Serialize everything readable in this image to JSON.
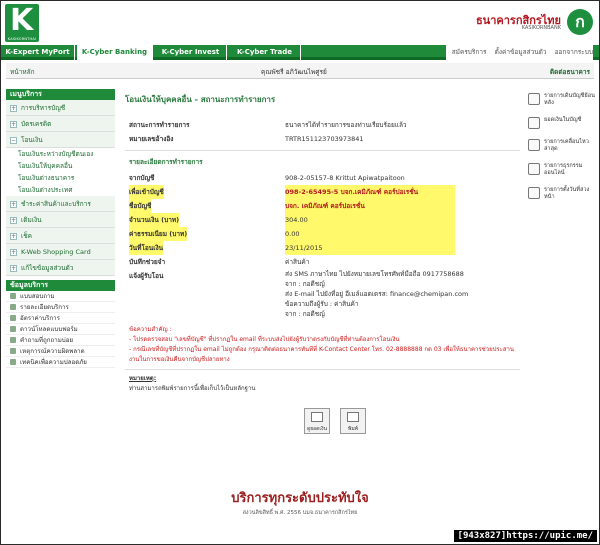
{
  "brand": {
    "logo_text": "K",
    "logo_sub": "KASIKORNTHAI",
    "bank_name": "ธนาคารกสิกรไทย",
    "bank_sub": "KASIKORNBANK"
  },
  "nav": {
    "tabs": [
      "K-Expert MyPort",
      "K-Cyber Banking",
      "K-Cyber Invest",
      "K-Cyber Trade"
    ],
    "active": "K-Cyber Banking"
  },
  "top_links": [
    "สมัครบริการ",
    "ตั้งค่าข้อมูลส่วนตัว",
    "ออกจากระบบ"
  ],
  "crumb": "หน้าหลัก",
  "user_name": "คุณพัชรี อภิวัฒนไพศูรย์",
  "contact": "ติดต่อธนาคาร",
  "sidebar": {
    "title": "เมนูบริการ",
    "items": [
      "การบริหารบัญชี",
      "บัตรเครดิต",
      "โอนเงิน"
    ],
    "subitems": [
      "โอนเงินระหว่างบัญชีตนเอง",
      "โอนเงินให้บุคคลอื่น",
      "โอนเงินต่างธนาคาร",
      "โอนเงินต่างประเทศ"
    ],
    "items2": [
      "ชำระค่าสินค้าและบริการ",
      "เติมเงิน",
      "เช็ค",
      "K-Web Shopping Card",
      "แก้ไขข้อมูลส่วนตัว"
    ],
    "aux_title": "ข้อมูลบริการ",
    "aux": [
      "แบบสอบถาม",
      "รายละเอียดบริการ",
      "อัตราค่าบริการ",
      "ดาวน์โหลดแบบฟอร์ม",
      "คำถามที่ถูกถามบ่อย",
      "เหตุการณ์ความผิดพลาด",
      "เทคนิคเพื่อความปลอดภัย"
    ]
  },
  "main": {
    "title": "โอนเงินให้บุคคลอื่น - สถานะการทำรายการ",
    "status_label": "สถานะการทำรายการ",
    "status_value": "ธนาคารได้ทำรายการของท่านเรียบร้อยแล้ว",
    "ref_label": "หมายเลขอ้างอิง",
    "ref_value": "TRTR151123703973841",
    "section": "รายละเอียดการทำรายการ",
    "from_label": "จากบัญชี",
    "from_value": "908-2-05157-8 Krittut Apiwatpaitoon",
    "to_label": "เพื่อเข้าบัญชี",
    "to_value": "098-2-65495-5 บจก.เคมิภัณฑ์ คอร์ปอเรชั่น",
    "name_label": "ชื่อบัญชี",
    "name_value": "บจก. เคมิภัณฑ์ คอร์ปอเรชั่น",
    "amount_label": "จำนวนเงิน (บาท)",
    "amount_value": "304.00",
    "fee_label": "ค่าธรรมเนียม (บาท)",
    "fee_value": "0.00",
    "date_label": "วันที่โอนเงิน",
    "date_value": "23/11/2015",
    "memo_label": "บันทึกช่วยจำ",
    "memo_value": "ค่าสินค้า",
    "notify_label": "แจ้งผู้รับโอน",
    "notify_lines": [
      "ส่ง SMS ภาษาไทย ไปยังหมายเลขโทรศัพท์มือถือ 0917758688",
      "จาก : กอดีชญ์",
      "ส่ง E-mail ไปยังที่อยู่ อีเมล์แอดเดรส: finance@chemipan.com",
      "ข้อความถึงผู้รับ : ค่าสินค้า",
      "จาก : กอดีชญ์"
    ],
    "note_title": "ข้อความสำคัญ :",
    "notes": [
      "- โปรดตรวจสอบ \"เลขที่บัญชี\" ที่ปรากฏใน email ที่ระบบส่งไปยังผู้รับว่าตรงกับบัญชีที่ท่านต้องการโอนเงิน",
      "- กรณีเลขที่บัญชีที่ปรากฏใน email ไม่ถูกต้อง กรุณาติดต่อธนาคารทันทีที่ K-Contact Center โทร. 02-8888888 กด 03 เพื่อให้ธนาคารช่วยประสานงานในการขอเงินคืนจากบัญชีปลายทาง"
    ],
    "remark_title": "หมายเหตุ:",
    "remark_text": "ท่านสามารถพิมพ์รายการนี้เพื่อเก็บไว้เป็นหลักฐาน",
    "btn_save": "ดูยอดเงิน",
    "btn_print": "พิมพ์"
  },
  "right_links": [
    "รายการเดินบัญชีย้อนหลัง",
    "ยอดเงินในบัญชี",
    "รายการเคลื่อนไหวล่าสุด",
    "รายการธุรกรรมออนไลน์",
    "รายการตั้งวันที่ล่วงหน้า"
  ],
  "footer": {
    "title": "บริการทุกระดับประทับใจ",
    "copy": "สงวนลิขสิทธิ์ พ.ศ. 2556 บมจ.ธนาคารกสิกรไทย"
  },
  "watermark": "[943x827]https://upic.me/"
}
